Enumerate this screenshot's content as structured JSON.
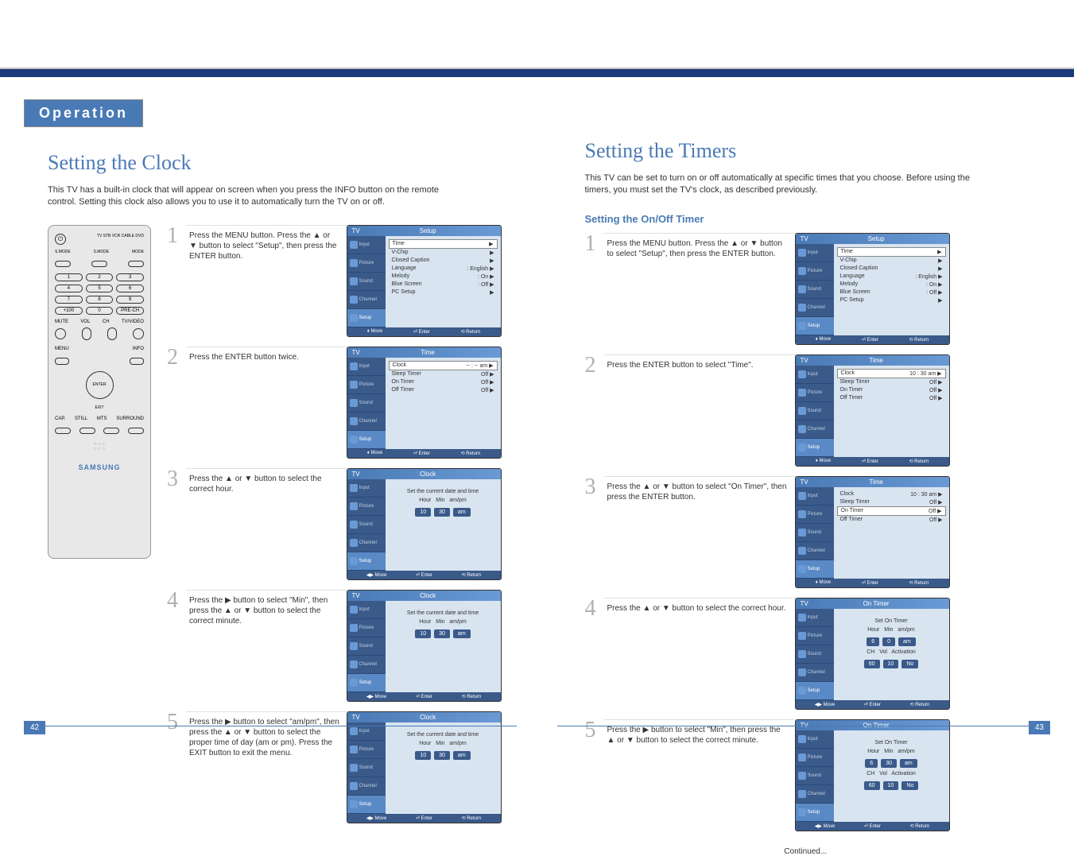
{
  "header": {
    "operation": "Operation"
  },
  "left": {
    "title": "Setting the Clock",
    "intro": "This TV has a built-in clock that will appear on screen when you press the INFO button on the remote control. Setting this clock also allows you to use it to automatically turn the TV on or off.",
    "remote": {
      "power": "POWER",
      "top_labels": "TV  STB  VCR  CABLE  DVD",
      "mode1": "S.MODE",
      "mode2": "S.MODE",
      "mode3": "MODE",
      "num1": "1",
      "num2": "2",
      "num3": "3",
      "num4": "4",
      "num5": "5",
      "num6": "6",
      "num7": "7",
      "num8": "8",
      "num9": "9",
      "num100": "+100",
      "num0": "0",
      "numPre": "PRE-CH",
      "mute": "MUTE",
      "tvvideo": "TV/VIDEO",
      "vol": "VOL",
      "ch": "CH",
      "menu": "MENU",
      "info": "INFO",
      "enter": "ENTER",
      "exit": "EXIT",
      "cap": "CAP.",
      "still": "STILL",
      "mts": "MTS",
      "surround": "SURROUND",
      "logo": "SAMSUNG"
    },
    "steps": {
      "s1": "Press the MENU button. Press the ▲ or ▼ button to select \"Setup\", then press the ENTER button.",
      "s2": "Press the ENTER button twice.",
      "s3": "Press the ▲ or ▼ button to select the correct hour.",
      "s4": "Press the ▶ button to select \"Min\", then press the ▲ or ▼ button to select the correct minute.",
      "s5": "Press the ▶ button to select \"am/pm\", then press the ▲ or ▼ button to select the proper time of day (am or pm). Press the EXIT button to exit the menu."
    },
    "osd": {
      "tv": "TV",
      "setup_title": "Setup",
      "time_title": "Time",
      "clock_title": "Clock",
      "tabs": {
        "input": "Input",
        "picture": "Picture",
        "sound": "Sound",
        "channel": "Channel",
        "setup": "Setup"
      },
      "setup_items": {
        "time": "Time",
        "vchip": "V-Chip",
        "cc": "Closed Caption",
        "lang": "Language",
        "lang_val": ": English",
        "melody": "Melody",
        "melody_val": ": On",
        "blue": "Blue Screen",
        "blue_val": ": Off",
        "pc": "PC Setup"
      },
      "time_items": {
        "clock": "Clock",
        "clock_val": "-- : --   am",
        "sleep": "Sleep Timer",
        "sleep_val": "Off",
        "on": "On Timer",
        "on_val": "Off",
        "off": "Off Timer",
        "off_val": "Off"
      },
      "clock_items": {
        "label": "Set the current date and time",
        "hour": "Hour",
        "min": "Min",
        "ampm": "am/pm",
        "h10": "10",
        "m30": "30",
        "am": "am"
      },
      "footer": {
        "move": "Move",
        "enter": "Enter",
        "return": "Return"
      }
    }
  },
  "right": {
    "title": "Setting the Timers",
    "intro": "This TV can be set to turn on or off automatically at specific times that you choose. Before using the timers, you must set the TV's clock, as described previously.",
    "subsection": "Setting the On/Off Timer",
    "steps": {
      "s1": "Press the MENU button. Press the ▲ or ▼ button to select \"Setup\", then press the ENTER button.",
      "s2": "Press the ENTER button to select \"Time\".",
      "s3": "Press the ▲ or ▼ button to select \"On Timer\", then press the ENTER button.",
      "s4": "Press the ▲ or ▼ button to select the correct hour.",
      "s5": "Press the ▶ button to select \"Min\", then press the ▲ or ▼ button to select the correct minute."
    },
    "osd": {
      "time_items": {
        "clock": "Clock",
        "clock_val": "10 : 30   am",
        "sleep": "Sleep Timer",
        "sleep_val": "Off",
        "on": "On Timer",
        "on_val": "Off",
        "off": "Off Timer",
        "off_val": "Off"
      },
      "ontimer_title": "On Timer",
      "ontimer": {
        "label": "Set On Timer",
        "hour": "Hour",
        "min": "Min",
        "ampm": "am/pm",
        "h6": "6",
        "m0": "0",
        "m30": "30",
        "am": "am",
        "ch": "CH",
        "vol": "Vol",
        "act": "Activation",
        "ch60": "60",
        "vol10": "10",
        "no": "No"
      }
    },
    "continued": "Continued..."
  },
  "pages": {
    "left": "42",
    "right": "43"
  }
}
